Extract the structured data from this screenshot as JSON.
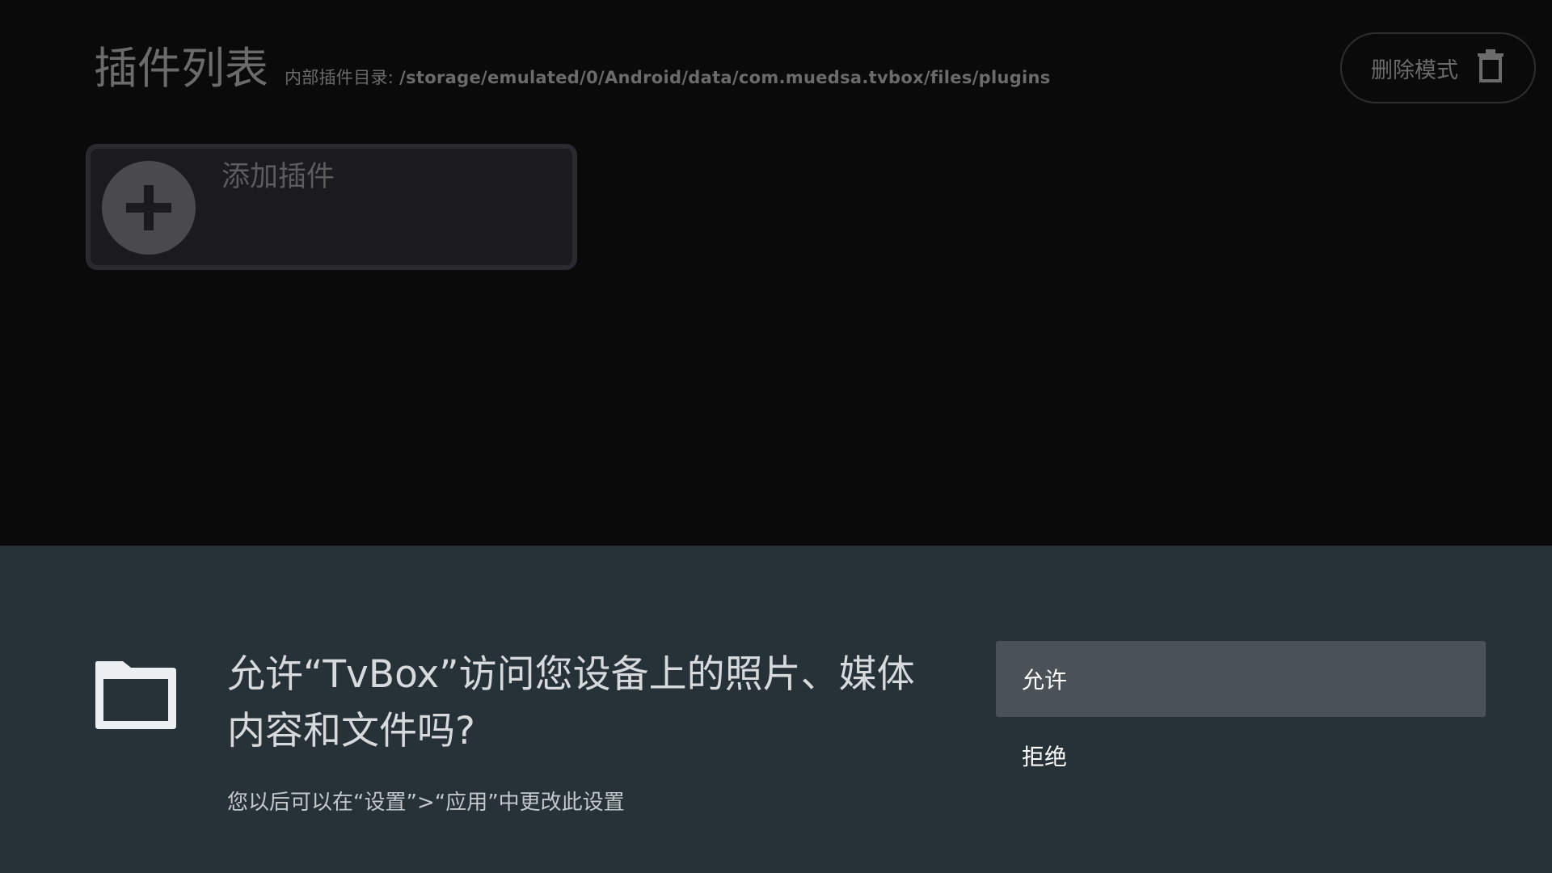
{
  "plugin_page": {
    "title": "插件列表",
    "dir_label": "内部插件目录: ",
    "dir_path": "/storage/emulated/0/Android/data/com.muedsa.tvbox/files/plugins",
    "delete_mode_label": "删除模式",
    "delete_icon": "trash-icon",
    "add_plugin_label": "添加插件",
    "add_icon": "plus-icon"
  },
  "permission_dialog": {
    "icon": "folder-icon",
    "message": "允许“TvBox”访问您设备上的照片、媒体内容和文件吗?",
    "detail": "您以后可以在“设置”>“应用”中更改此设置",
    "allow_label": "允许",
    "deny_label": "拒绝"
  },
  "colors": {
    "page_background": "#0a0a0a",
    "dialog_background": "#263238",
    "focused_button": "#4a5157"
  }
}
